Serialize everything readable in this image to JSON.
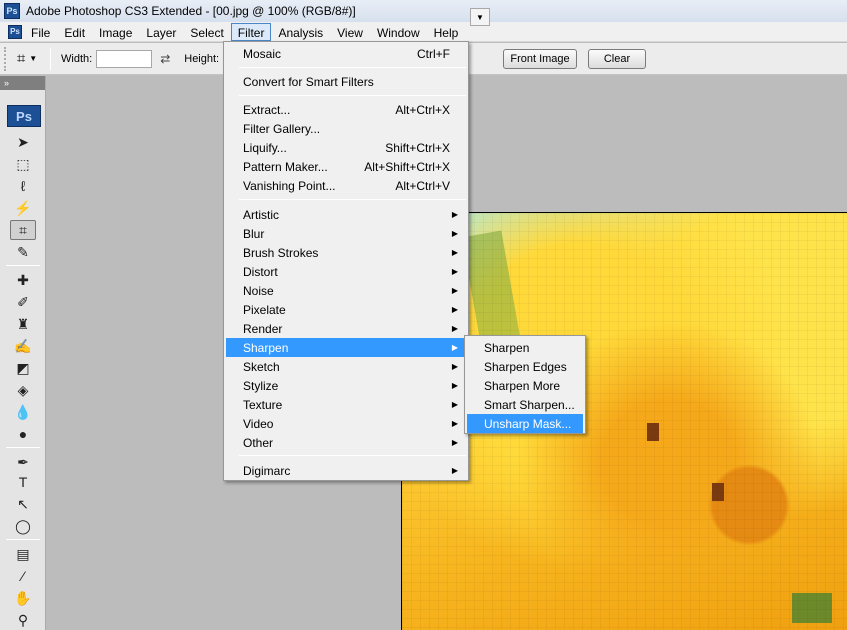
{
  "window": {
    "app_icon": "Ps",
    "title": "Adobe Photoshop CS3 Extended - [00.jpg @ 100% (RGB/8#)]"
  },
  "menubar": {
    "items": [
      "File",
      "Edit",
      "Image",
      "Layer",
      "Select",
      "Filter",
      "Analysis",
      "View",
      "Window",
      "Help"
    ],
    "active": "Filter"
  },
  "options": {
    "width_label": "Width:",
    "height_label": "Height:",
    "front_image_label": "Front Image",
    "clear_label": "Clear",
    "swap_icon": "swap-arrows-icon"
  },
  "toolbox": {
    "logo": "Ps",
    "selected_tool": "crop"
  },
  "filter_menu": {
    "group1": [
      {
        "label": "Mosaic",
        "shortcut": "Ctrl+F"
      }
    ],
    "group2": [
      {
        "label": "Convert for Smart Filters",
        "shortcut": ""
      }
    ],
    "group3": [
      {
        "label": "Extract...",
        "shortcut": "Alt+Ctrl+X"
      },
      {
        "label": "Filter Gallery...",
        "shortcut": ""
      },
      {
        "label": "Liquify...",
        "shortcut": "Shift+Ctrl+X"
      },
      {
        "label": "Pattern Maker...",
        "shortcut": "Alt+Shift+Ctrl+X"
      },
      {
        "label": "Vanishing Point...",
        "shortcut": "Alt+Ctrl+V"
      }
    ],
    "group4": [
      {
        "label": "Artistic"
      },
      {
        "label": "Blur"
      },
      {
        "label": "Brush Strokes"
      },
      {
        "label": "Distort"
      },
      {
        "label": "Noise"
      },
      {
        "label": "Pixelate"
      },
      {
        "label": "Render"
      },
      {
        "label": "Sharpen"
      },
      {
        "label": "Sketch"
      },
      {
        "label": "Stylize"
      },
      {
        "label": "Texture"
      },
      {
        "label": "Video"
      },
      {
        "label": "Other"
      }
    ],
    "group5": [
      {
        "label": "Digimarc"
      }
    ],
    "highlighted": "Sharpen"
  },
  "sharpen_submenu": {
    "items": [
      "Sharpen",
      "Sharpen Edges",
      "Sharpen More",
      "Smart Sharpen...",
      "Unsharp Mask..."
    ],
    "highlighted": "Unsharp Mask..."
  },
  "colors": {
    "highlight": "#3399ff",
    "menu_bg": "#f0f0f0",
    "canvas_bg": "#bcbcbc"
  }
}
